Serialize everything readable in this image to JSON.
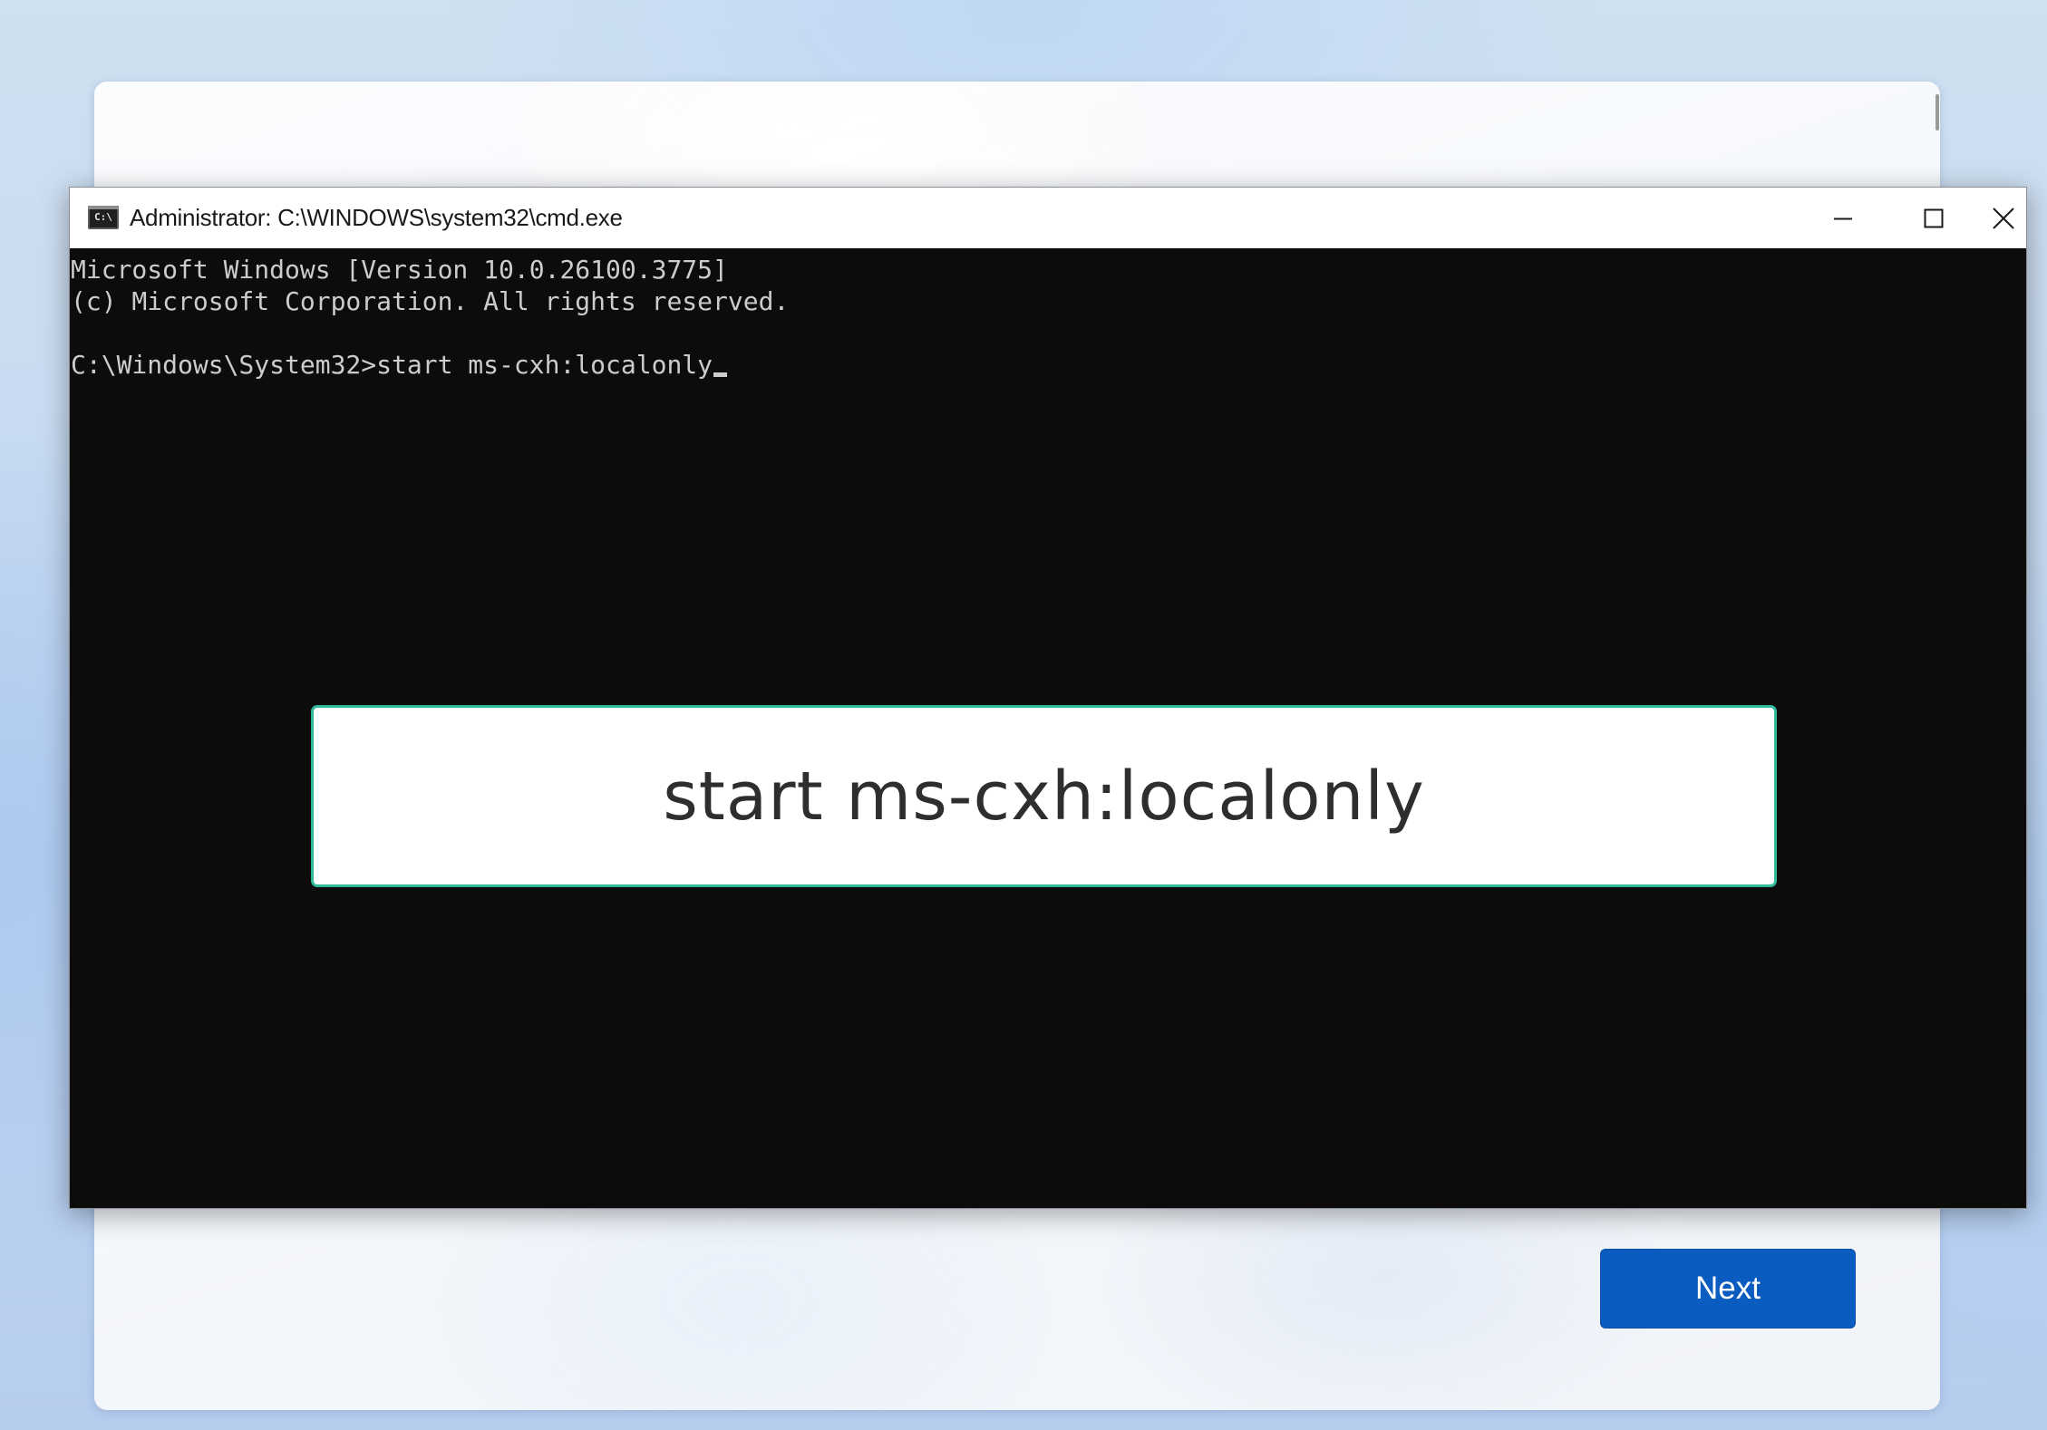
{
  "oobe": {
    "next_label": "Next",
    "accent_color": "#0b5cc1"
  },
  "console_window": {
    "title": "Administrator: C:\\WINDOWS\\system32\\cmd.exe",
    "icon": "cmd-icon",
    "icon_text": "C:\\",
    "caption_buttons": [
      "minimize-icon",
      "maximize-icon",
      "close-icon"
    ],
    "lines": {
      "version": "Microsoft Windows [Version 10.0.26100.3775]",
      "copyright": "(c) Microsoft Corporation. All rights reserved.",
      "prompt": "C:\\Windows\\System32>",
      "command": "start ms-cxh:localonly"
    },
    "background_color": "#0c0c0c",
    "text_color": "#cccccc"
  },
  "callout": {
    "text": "start ms-cxh:localonly",
    "border_color": "#2fb89a"
  }
}
